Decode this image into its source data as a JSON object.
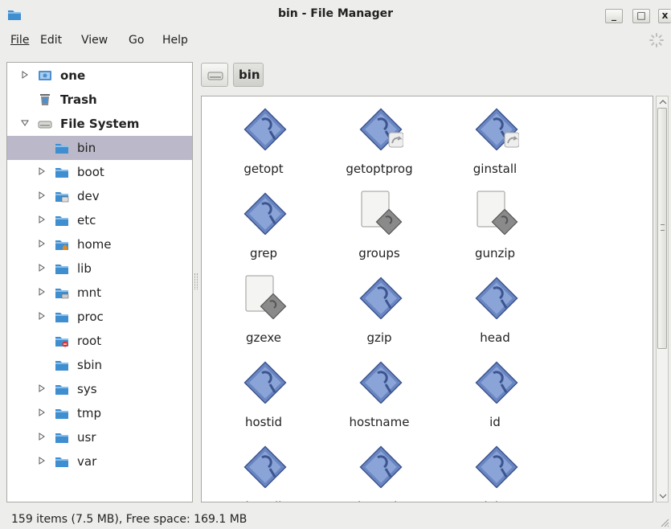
{
  "window": {
    "title": "bin - File Manager",
    "minimize": "_",
    "maximize": "□",
    "close": "x"
  },
  "menubar": {
    "items": [
      "File",
      "Edit",
      "View",
      "Go",
      "Help"
    ]
  },
  "sidebar": {
    "places": [
      {
        "label": "one",
        "icon": "drive-icon"
      },
      {
        "label": "Trash",
        "icon": "trash-icon"
      },
      {
        "label": "File System",
        "icon": "harddisk-icon"
      }
    ],
    "folders": [
      {
        "label": "bin",
        "selected": true,
        "expandable": false,
        "icon": "folder-icon"
      },
      {
        "label": "boot",
        "expandable": true,
        "icon": "folder-icon"
      },
      {
        "label": "dev",
        "expandable": true,
        "icon": "folder-device-icon"
      },
      {
        "label": "etc",
        "expandable": true,
        "icon": "folder-icon"
      },
      {
        "label": "home",
        "expandable": true,
        "icon": "folder-home-icon"
      },
      {
        "label": "lib",
        "expandable": true,
        "icon": "folder-icon"
      },
      {
        "label": "mnt",
        "expandable": true,
        "icon": "folder-mount-icon"
      },
      {
        "label": "proc",
        "expandable": true,
        "icon": "folder-icon"
      },
      {
        "label": "root",
        "expandable": false,
        "icon": "folder-locked-icon"
      },
      {
        "label": "sbin",
        "expandable": false,
        "icon": "folder-icon"
      },
      {
        "label": "sys",
        "expandable": true,
        "icon": "folder-icon"
      },
      {
        "label": "tmp",
        "expandable": true,
        "icon": "folder-icon"
      },
      {
        "label": "usr",
        "expandable": true,
        "icon": "folder-icon"
      },
      {
        "label": "var",
        "expandable": true,
        "icon": "folder-icon"
      }
    ]
  },
  "pathbar": {
    "current": "bin"
  },
  "files": [
    {
      "name": "getopt",
      "type": "executable"
    },
    {
      "name": "getoptprog",
      "type": "executable-link"
    },
    {
      "name": "ginstall",
      "type": "executable-link"
    },
    {
      "name": "grep",
      "type": "executable"
    },
    {
      "name": "groups",
      "type": "script"
    },
    {
      "name": "gunzip",
      "type": "script"
    },
    {
      "name": "gzexe",
      "type": "script"
    },
    {
      "name": "gzip",
      "type": "executable"
    },
    {
      "name": "head",
      "type": "executable"
    },
    {
      "name": "hostid",
      "type": "executable"
    },
    {
      "name": "hostname",
      "type": "executable"
    },
    {
      "name": "id",
      "type": "executable"
    },
    {
      "name": "install",
      "type": "executable"
    },
    {
      "name": "ipmask",
      "type": "executable"
    },
    {
      "name": "join",
      "type": "executable"
    }
  ],
  "status": {
    "text": "159 items (7.5 MB), Free space: 169.1 MB"
  },
  "colors": {
    "selection": "#bbb8c9",
    "folder": "#3f8ed0",
    "exec_diamond": "#6a86c2"
  }
}
